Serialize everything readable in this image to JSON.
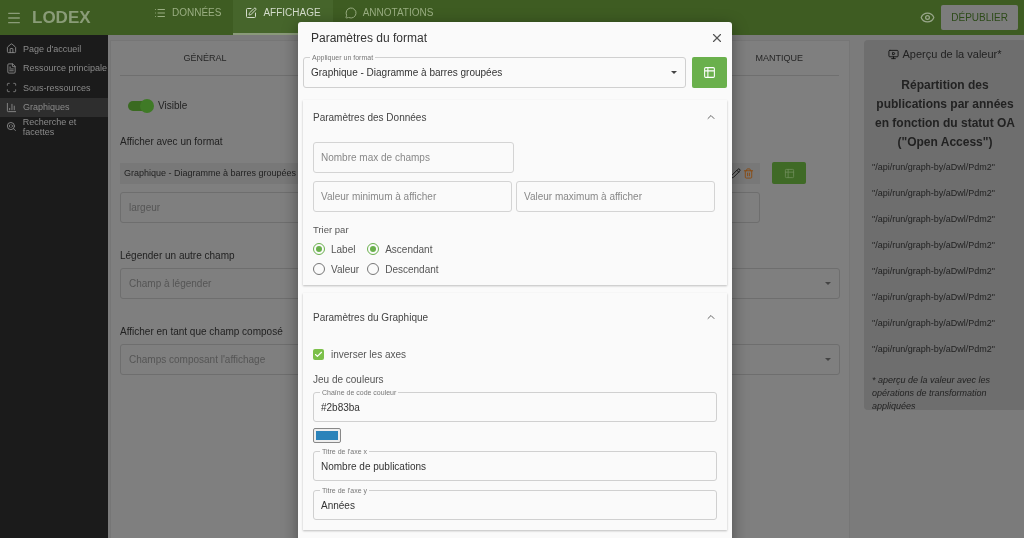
{
  "app_bar": {
    "logo": "LODEX",
    "tabs": [
      {
        "label": "DONNÉES",
        "selected": false
      },
      {
        "label": "AFFICHAGE",
        "selected": true
      },
      {
        "label": "ANNOTATIONS",
        "selected": false
      }
    ],
    "publish_button": {
      "label": "DÉPUBLIER",
      "disabled": true
    }
  },
  "sidebar": {
    "items": [
      {
        "label": "Page d'accueil",
        "selected": false
      },
      {
        "label": "Ressource principale",
        "selected": false
      },
      {
        "label": "Sous-ressources",
        "selected": false
      },
      {
        "label": "Graphiques",
        "selected": true
      },
      {
        "label": "Recherche et facettes",
        "selected": false
      }
    ]
  },
  "editor": {
    "tabs": [
      {
        "label": "GÉNÉRAL"
      },
      {
        "label": "MANTIQUE"
      }
    ],
    "visible_toggle": {
      "label": "Visible",
      "on": true
    },
    "format_label": "Afficher avec un format",
    "format_value": "Graphique - Diagramme à barres groupées",
    "width_field": {
      "placeholder": "largeur"
    },
    "caption_label": "Légender un autre champ",
    "caption_field": {
      "placeholder": "Champ à légender"
    },
    "composed_label": "Afficher en tant que champ composé",
    "composed_field": {
      "placeholder": "Champs composant l'affichage"
    }
  },
  "preview": {
    "title": "Aperçu de la valeur*",
    "heading": "Répartition des publications par années en fonction du statut OA (\"Open Access\")",
    "values": [
      "\"/api/run/graph-by/aDwl/Pdm2\"",
      "\"/api/run/graph-by/aDwl/Pdm2\"",
      "\"/api/run/graph-by/aDwl/Pdm2\"",
      "\"/api/run/graph-by/aDwl/Pdm2\"",
      "\"/api/run/graph-by/aDwl/Pdm2\"",
      "\"/api/run/graph-by/aDwl/Pdm2\"",
      "\"/api/run/graph-by/aDwl/Pdm2\"",
      "\"/api/run/graph-by/aDwl/Pdm2\""
    ],
    "footnote": "* aperçu de la valeur avec les opérations de transformation appliquées"
  },
  "dialog": {
    "title": "Paramètres du format",
    "format_select": {
      "label": "Appliquer un format",
      "value": "Graphique - Diagramme à barres groupées"
    },
    "data_section": {
      "title": "Paramètres des Données",
      "expanded": true,
      "max_fields": {
        "placeholder": "Nombre max de champs"
      },
      "min_value": {
        "placeholder": "Valeur minimum à afficher"
      },
      "max_value": {
        "placeholder": "Valeur maximum à afficher"
      },
      "sort_label": "Trier par",
      "sort_by": [
        {
          "label": "Label",
          "selected": true
        },
        {
          "label": "Valeur",
          "selected": false
        }
      ],
      "order": [
        {
          "label": "Ascendant",
          "selected": true
        },
        {
          "label": "Descendant",
          "selected": false
        }
      ]
    },
    "chart_section": {
      "title": "Paramètres du Graphique",
      "expanded": true,
      "invert_axes": {
        "label": "inverser les axes",
        "checked": true
      },
      "colors_label": "Jeu de couleurs",
      "color_field": {
        "label": "Chaîne de code couleur",
        "value": "#2b83ba"
      },
      "swatch": {
        "color": "#2b83ba"
      },
      "x_title": {
        "label": "Titre de l'axe x",
        "value": "Nombre de publications"
      },
      "y_title": {
        "label": "Titre de l'axe y",
        "value": "Années"
      }
    }
  }
}
